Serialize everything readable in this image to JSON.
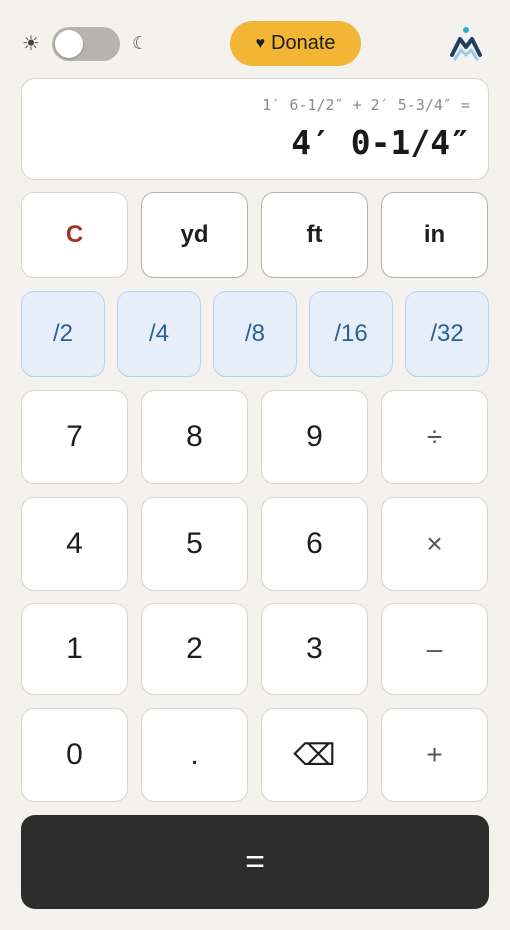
{
  "theme": {
    "light_icon": "☀",
    "dark_icon": "☾",
    "toggle_state": "light"
  },
  "header": {
    "donate_icon": "♥",
    "donate_label": "Donate",
    "logo_icon": "mountain-logo-icon"
  },
  "display": {
    "expression": "1′ 6-1/2″ + 2′ 5-3/4″ =",
    "result": "4′ 0-1/4″"
  },
  "unit_row": {
    "clear": "C",
    "yd": "yd",
    "ft": "ft",
    "in": "in"
  },
  "fraction_row": [
    "/2",
    "/4",
    "/8",
    "/16",
    "/32"
  ],
  "keypad": {
    "seven": "7",
    "eight": "8",
    "nine": "9",
    "divide": "÷",
    "four": "4",
    "five": "5",
    "six": "6",
    "multiply": "×",
    "one": "1",
    "two": "2",
    "three": "3",
    "minus": "–",
    "zero": "0",
    "dot": ".",
    "backspace": "⌫",
    "plus": "+",
    "equals": "="
  },
  "colors": {
    "background": "#f4f2ee",
    "donate": "#f2b534",
    "clear_text": "#a3302a",
    "fraction_bg": "#e6eff9",
    "fraction_text": "#2b5f98",
    "equals_bg": "#2c2c2c",
    "logo_dark": "#1f3f63",
    "logo_light": "#9ec9e6",
    "logo_dot": "#2fa8d8"
  }
}
